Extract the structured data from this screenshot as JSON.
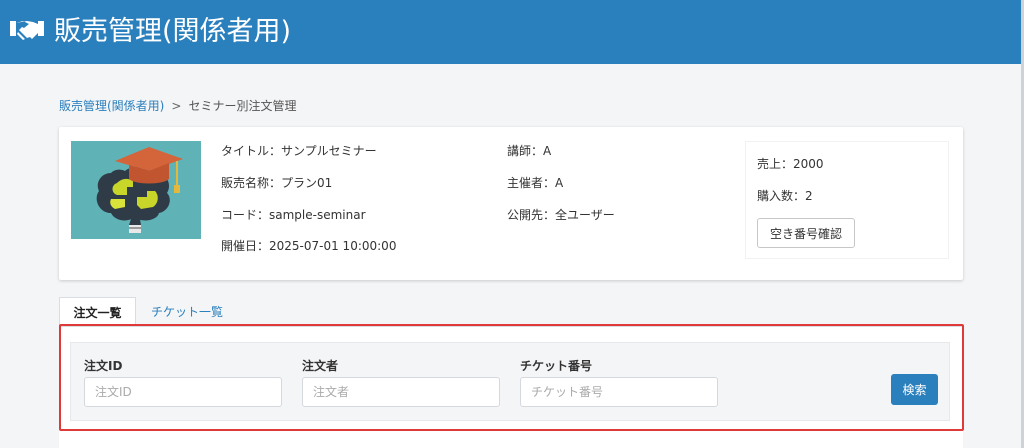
{
  "header": {
    "icon": "handshake-icon",
    "title": "販売管理(関係者用)",
    "background": "#2a7fbd"
  },
  "breadcrumb": {
    "parent_label": "販売管理(関係者用)",
    "separator": ">",
    "current_label": "セミナー別注文管理"
  },
  "seminar": {
    "thumbnail_icon": "graduation-brain-image",
    "title_line": "タイトル：サンプルセミナー",
    "sales_name_line": "販売名称：プラン01",
    "code_line": "コード：sample-seminar",
    "date_line": "開催日：2025-07-01 10:00:00",
    "instructor_line": "講師：A",
    "organizer_line": "主催者：A",
    "visibility_line": "公開先：全ユーザー"
  },
  "stats": {
    "sales_line": "売上：2000",
    "purchases_line": "購入数：2",
    "vacancy_button_label": "空き番号確認"
  },
  "tabs": {
    "orders_label": "注文一覧",
    "tickets_label": "チケット一覧"
  },
  "search": {
    "order_id_label": "注文ID",
    "order_id_placeholder": "注文ID",
    "order_id_value": "",
    "orderer_label": "注文者",
    "orderer_placeholder": "注文者",
    "orderer_value": "",
    "ticket_label": "チケット番号",
    "ticket_placeholder": "チケット番号",
    "ticket_value": "",
    "search_button_label": "検索",
    "highlight_color": "#e0393a"
  }
}
